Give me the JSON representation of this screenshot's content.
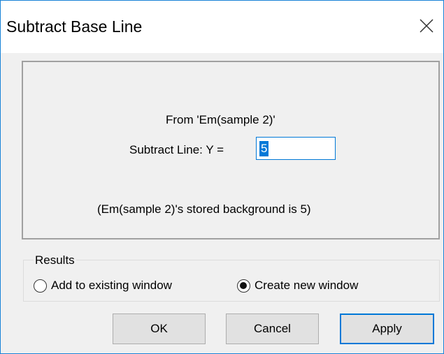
{
  "window": {
    "title": "Subtract Base Line"
  },
  "panel": {
    "from_text": "From 'Em(sample 2)'",
    "subtract_label": "Subtract Line: Y =",
    "y_value": "5",
    "background_note": "(Em(sample 2)'s stored background is 5)"
  },
  "results": {
    "legend": "Results",
    "options": [
      {
        "label": "Add to existing window",
        "selected": false
      },
      {
        "label": "Create new window",
        "selected": true
      }
    ]
  },
  "buttons": {
    "ok": "OK",
    "cancel": "Cancel",
    "apply": "Apply"
  },
  "icons": {
    "close": "close-icon"
  },
  "colors": {
    "accent": "#0078d7",
    "window_border": "#1883d7"
  }
}
